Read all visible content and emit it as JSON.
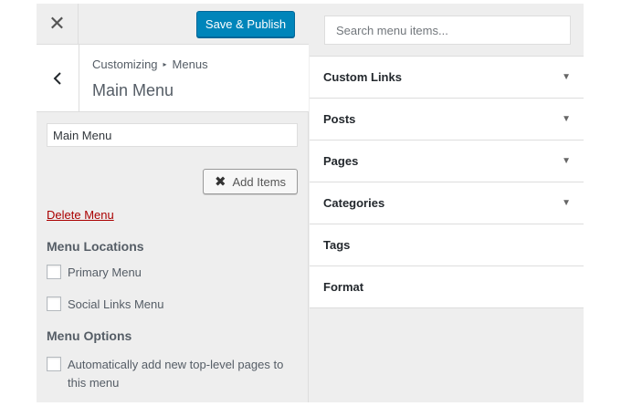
{
  "topbar": {
    "close_icon": "close-icon",
    "publish_label": "Save & Publish",
    "accent_color": "#0085ba"
  },
  "header": {
    "breadcrumb": [
      "Customizing",
      "Menus"
    ],
    "breadcrumb_sep": "▸",
    "title": "Main Menu"
  },
  "menu": {
    "name_value": "Main Menu",
    "add_items_label": "Add Items",
    "delete_label": "Delete Menu",
    "delete_color": "#aa0000"
  },
  "locations": {
    "heading": "Menu Locations",
    "items": [
      {
        "label": "Primary Menu",
        "checked": false
      },
      {
        "label": "Social Links Menu",
        "checked": false
      }
    ]
  },
  "options": {
    "heading": "Menu Options",
    "items": [
      {
        "label_line1": "Automatically add new top-level pages to",
        "label_line2": "this menu",
        "checked": false
      }
    ]
  },
  "search": {
    "placeholder": "Search menu items..."
  },
  "item_types": [
    {
      "label": "Custom Links",
      "expandable": true
    },
    {
      "label": "Posts",
      "expandable": true
    },
    {
      "label": "Pages",
      "expandable": true
    },
    {
      "label": "Categories",
      "expandable": true
    },
    {
      "label": "Tags",
      "expandable": false
    },
    {
      "label": "Format",
      "expandable": false
    }
  ]
}
